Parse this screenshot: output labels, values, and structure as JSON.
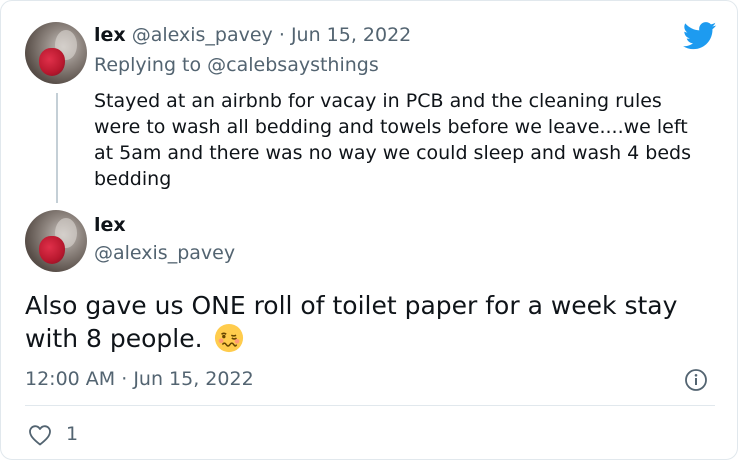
{
  "reply_tweet": {
    "name": "lex",
    "handle": "@alexis_pavey",
    "date_sep": "·",
    "date": "Jun 15, 2022",
    "replying_prefix": "Replying to",
    "replying_to": "@calebsaysthings",
    "text": "Stayed at an airbnb for vacay in PCB and the cleaning rules were to wash all bedding and towels before we leave....we left at 5am and there was no way we could sleep and wash 4 beds bedding"
  },
  "main_tweet": {
    "name": "lex",
    "handle": "@alexis_pavey",
    "text": "Also gave us ONE roll of toilet paper for a week stay with 8 people.",
    "emoji": "woozy-face",
    "time": "12:00 AM",
    "date_sep": "·",
    "date": "Jun 15, 2022",
    "like_count": "1"
  },
  "icons": {
    "brand": "twitter-bird-icon",
    "info": "info-icon",
    "like": "heart-icon"
  },
  "colors": {
    "twitter_blue": "#1d9bf0",
    "muted_text": "#536471",
    "text": "#0f1419",
    "border": "#e1e8ed"
  }
}
